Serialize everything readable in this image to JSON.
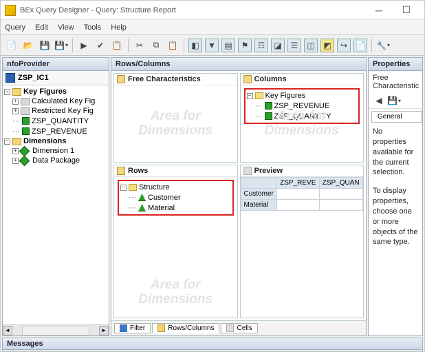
{
  "window": {
    "title": "BEx Query Designer - Query: Structure Report"
  },
  "menu": {
    "query": "Query",
    "edit": "Edit",
    "view": "View",
    "tools": "Tools",
    "help": "Help"
  },
  "left_panel": {
    "title": "nfoProvider",
    "cube": "ZSP_IC1",
    "kf_folder": "Key Figures",
    "kf_calc": "Calculated Key Fig",
    "kf_restr": "Restricted Key Fig",
    "kf1": "ZSP_QUANTITY",
    "kf2": "ZSP_REVENUE",
    "dim_folder": "Dimensions",
    "dim1": "Dimension 1",
    "dim2": "Data Package"
  },
  "mid_panel": {
    "title": "Rows/Columns",
    "free_char": "Free Characteristics",
    "columns": "Columns",
    "col_kf": "Key Figures",
    "col_kf1": "ZSP_REVENUE",
    "col_kf2": "ZSP_QUANTITY",
    "rows": "Rows",
    "row_struct": "Structure",
    "row1": "Customer",
    "row2": "Material",
    "preview": "Preview",
    "pv_col1": "ZSP_REVE",
    "pv_col2": "ZSP_QUAN",
    "pv_row1": "Customer",
    "pv_row2": "Material",
    "wm_area": "Area for",
    "wm_dim": "Dimensions",
    "tabs": {
      "filter": "Filter",
      "rows": "Rows/Columns",
      "cells": "Cells"
    }
  },
  "right_panel": {
    "title": "Properties",
    "section": "Free Characteristic",
    "tab_general": "General",
    "note1": "No properties available for the current selection.",
    "note2": "To display properties, choose one or more objects of the same type."
  },
  "messages": {
    "title": "Messages"
  }
}
